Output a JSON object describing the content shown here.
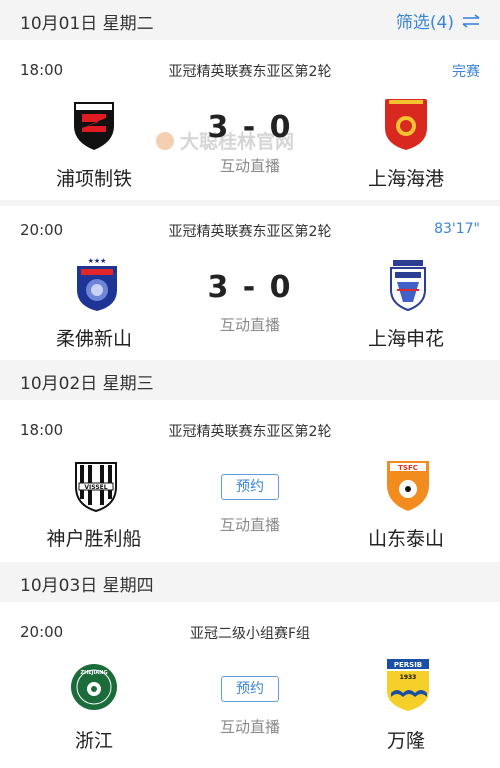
{
  "filter": {
    "label": "筛选(4)",
    "icon": "filter-sliders-icon"
  },
  "watermark": {
    "text": "大聪桂林官网"
  },
  "days": [
    {
      "date": "10月01日 星期二"
    },
    {
      "date": "10月02日 星期三"
    },
    {
      "date": "10月03日 星期四"
    }
  ],
  "matches": [
    {
      "time": "18:00",
      "league": "亚冠精英联赛东亚区第2轮",
      "status": "完赛",
      "home": "浦项制铁",
      "away": "上海海港",
      "score": "3 - 0",
      "live": "互动直播",
      "home_logo": "pohang-steelers-logo",
      "away_logo": "shanghai-port-logo"
    },
    {
      "time": "20:00",
      "league": "亚冠精英联赛东亚区第2轮",
      "status": "83'17\"",
      "home": "柔佛新山",
      "away": "上海申花",
      "score": "3 - 0",
      "live": "互动直播",
      "home_logo": "johor-darul-tazim-logo",
      "away_logo": "shanghai-shenhua-logo"
    },
    {
      "time": "18:00",
      "league": "亚冠精英联赛东亚区第2轮",
      "button": "预约",
      "home": "神户胜利船",
      "away": "山东泰山",
      "live": "互动直播",
      "home_logo": "vissel-kobe-logo",
      "away_logo": "shandong-taishan-logo"
    },
    {
      "time": "20:00",
      "league": "亚冠二级小组赛F组",
      "button": "预约",
      "home": "浙江",
      "away": "万隆",
      "live": "互动直播",
      "home_logo": "zhejiang-fc-logo",
      "away_logo": "persib-bandung-logo",
      "home_logo_text": "ZHEJIANG",
      "away_logo_text": "PERSIB 1933"
    }
  ],
  "colors": {
    "accent": "#3a85d8",
    "header_bg": "#f4f4f4"
  }
}
